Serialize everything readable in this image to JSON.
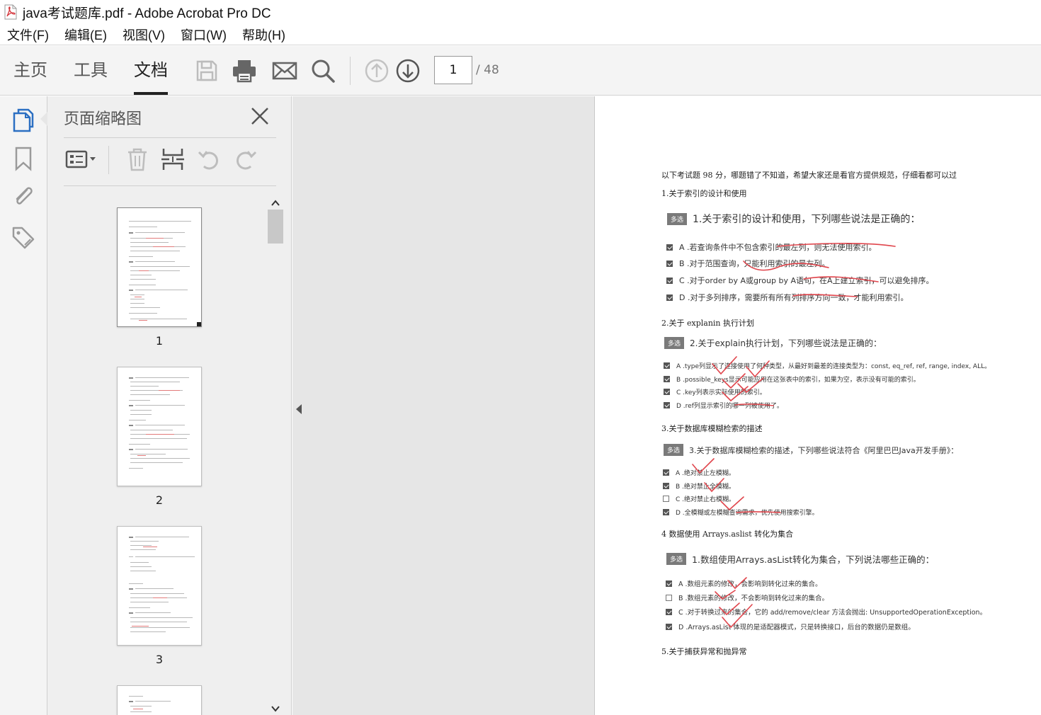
{
  "window": {
    "title": "java考试题库.pdf - Adobe Acrobat Pro DC",
    "accent_red": "#d4343a"
  },
  "menu": [
    "文件(F)",
    "编辑(E)",
    "视图(V)",
    "窗口(W)",
    "帮助(H)"
  ],
  "toolbar": {
    "tabs": [
      "主页",
      "工具",
      "文档"
    ],
    "active_tab": "文档",
    "icons": [
      "save-icon",
      "print-icon",
      "email-icon",
      "search-icon",
      "page-up-icon",
      "page-down-icon"
    ],
    "current_page": "1",
    "total_pages": "/ 48"
  },
  "rail": {
    "icons": [
      "page-thumbnails-icon",
      "bookmark-icon",
      "attachment-icon",
      "tag-icon"
    ]
  },
  "thumbnails_panel": {
    "title": "页面缩略图",
    "tools": [
      "thumbnail-options-icon",
      "delete-page-icon",
      "insert-page-icon",
      "rotate-ccw-icon",
      "rotate-cw-icon"
    ],
    "pages": [
      "1",
      "2",
      "3"
    ]
  },
  "document": {
    "intro": "以下考试题 98 分，哪题错了不知道，希望大家还是看官方提供规范，仔细看都可以过",
    "sections": [
      {
        "heading": "1.关于索引的设计和使用",
        "badge": "多选",
        "question": "1.关于索引的设计和使用，下列哪些说法是正确的：",
        "options": [
          {
            "text": "A .若查询条件中不包含索引的最左列，则无法使用索引。",
            "checked": true
          },
          {
            "text": "B .对于范围查询，只能利用索引的最左列。",
            "checked": true
          },
          {
            "text": "C .对于order by A或group by A语句，在A上建立索引，可以避免排序。",
            "checked": true
          },
          {
            "text": "D .对于多列排序，需要所有所有列排序方向一致，才能利用索引。",
            "checked": true
          }
        ]
      },
      {
        "heading": "2.关于 explanin 执行计划",
        "badge": "多选",
        "question": "2.关于explain执行计划，下列哪些说法是正确的：",
        "options": [
          {
            "text": "A .type列显示了连接使用了何种类型，从最好到最差的连接类型为：const, eq_ref, ref, range, index, ALL。",
            "checked": true
          },
          {
            "text": "B .possible_keys显示可能应用在这张表中的索引，如果为空，表示没有可能的索引。",
            "checked": true
          },
          {
            "text": "C .key列表示实际使用的索引。",
            "checked": true
          },
          {
            "text": "D .ref列显示索引的哪一列被使用了。",
            "checked": true
          }
        ]
      },
      {
        "heading": "3.关于数据库模糊检索的描述",
        "badge": "多选",
        "question": "3.关于数据库模糊检索的描述，下列哪些说法符合《阿里巴巴Java开发手册》：",
        "options": [
          {
            "text": "A .绝对禁止左模糊。",
            "checked": true
          },
          {
            "text": "B .绝对禁止全模糊。",
            "checked": true
          },
          {
            "text": "C .绝对禁止右模糊。",
            "checked": false
          },
          {
            "text": "D .全模糊或左模糊查询需求，优先使用搜索引擎。",
            "checked": true
          }
        ]
      },
      {
        "heading": "4 数据使用 Arrays.aslist 转化为集合",
        "badge": "多选",
        "question": "1.数组使用Arrays.asList转化为集合，下列说法哪些正确的：",
        "options": [
          {
            "text": "A .数组元素的修改，会影响到转化过来的集合。",
            "checked": true
          },
          {
            "text": "B .数组元素的修改，不会影响到转化过来的集合。",
            "checked": false
          },
          {
            "text": "C .对于转换过来的集合，它的 add/remove/clear 方法会抛出: UnsupportedOperationException。",
            "checked": true
          },
          {
            "text": "D .Arrays.asList 体现的是适配器模式，只是转换接口，后台的数据仍是数组。",
            "checked": true
          }
        ]
      },
      {
        "heading": "5.关于捕获异常和抛异常"
      }
    ]
  }
}
